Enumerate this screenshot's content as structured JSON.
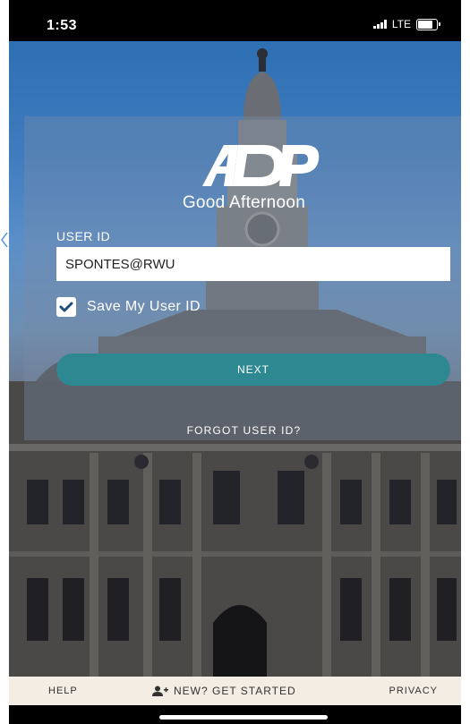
{
  "status_bar": {
    "time": "1:53",
    "network": "LTE"
  },
  "login": {
    "greeting": "Good Afternoon",
    "user_id_label": "USER ID",
    "user_id_value": "SPONTES@RWU",
    "save_label": "Save My User ID",
    "save_checked": true,
    "next_label": "NEXT",
    "forgot_label": "FORGOT USER ID?"
  },
  "footer": {
    "help_label": "HELP",
    "new_label": "NEW? GET STARTED",
    "privacy_label": "PRIVACY"
  },
  "colors": {
    "accent": "#2e8892",
    "footer_bg": "#f3ede4"
  },
  "icons": {
    "logo": "adp-logo",
    "checkbox": "checkmark-icon",
    "new_user": "add-user-icon"
  }
}
